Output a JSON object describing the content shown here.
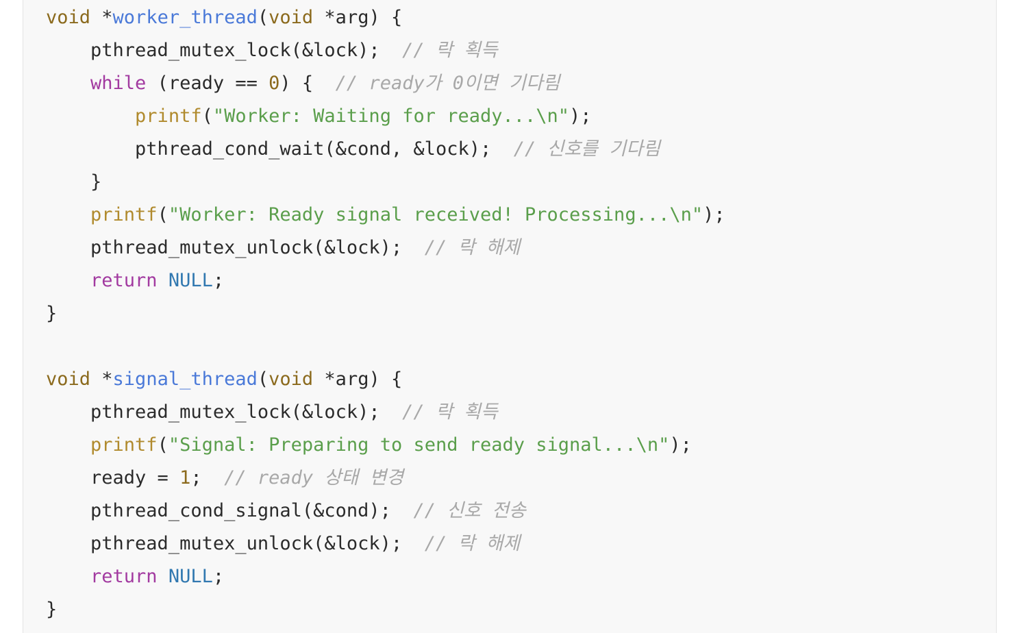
{
  "colors": {
    "background": "#f8f8f8",
    "page": "#ffffff",
    "border": "#e3e3e3",
    "plain": "#2b2b2b",
    "type": "#8b6a1d",
    "function_name": "#4a79d8",
    "keyword": "#a23aa0",
    "builtin": "#b08a2d",
    "string": "#5a9e4b",
    "number": "#8b6a1d",
    "constant": "#3178b0",
    "comment": "#a8a8a8"
  },
  "code": {
    "lines": [
      [
        {
          "t": "type",
          "v": "void"
        },
        {
          "t": "plain",
          "v": " *"
        },
        {
          "t": "func",
          "v": "worker_thread"
        },
        {
          "t": "plain",
          "v": "("
        },
        {
          "t": "type",
          "v": "void"
        },
        {
          "t": "plain",
          "v": " *arg) {"
        }
      ],
      [
        {
          "t": "plain",
          "v": "    pthread_mutex_lock(&lock);  "
        },
        {
          "t": "comment",
          "v": "// 락 획득"
        }
      ],
      [
        {
          "t": "plain",
          "v": "    "
        },
        {
          "t": "kw",
          "v": "while"
        },
        {
          "t": "plain",
          "v": " (ready == "
        },
        {
          "t": "num",
          "v": "0"
        },
        {
          "t": "plain",
          "v": ") {  "
        },
        {
          "t": "comment",
          "v": "// ready가 0이면 기다림"
        }
      ],
      [
        {
          "t": "plain",
          "v": "        "
        },
        {
          "t": "builtin",
          "v": "printf"
        },
        {
          "t": "plain",
          "v": "("
        },
        {
          "t": "string",
          "v": "\"Worker: Waiting for ready...\\n\""
        },
        {
          "t": "plain",
          "v": ");"
        }
      ],
      [
        {
          "t": "plain",
          "v": "        pthread_cond_wait(&cond, &lock);  "
        },
        {
          "t": "comment",
          "v": "// 신호를 기다림"
        }
      ],
      [
        {
          "t": "plain",
          "v": "    }"
        }
      ],
      [
        {
          "t": "plain",
          "v": "    "
        },
        {
          "t": "builtin",
          "v": "printf"
        },
        {
          "t": "plain",
          "v": "("
        },
        {
          "t": "string",
          "v": "\"Worker: Ready signal received! Processing...\\n\""
        },
        {
          "t": "plain",
          "v": ");"
        }
      ],
      [
        {
          "t": "plain",
          "v": "    pthread_mutex_unlock(&lock);  "
        },
        {
          "t": "comment",
          "v": "// 락 해제"
        }
      ],
      [
        {
          "t": "plain",
          "v": "    "
        },
        {
          "t": "kw",
          "v": "return"
        },
        {
          "t": "plain",
          "v": " "
        },
        {
          "t": "const",
          "v": "NULL"
        },
        {
          "t": "plain",
          "v": ";"
        }
      ],
      [
        {
          "t": "plain",
          "v": "}"
        }
      ],
      [],
      [
        {
          "t": "type",
          "v": "void"
        },
        {
          "t": "plain",
          "v": " *"
        },
        {
          "t": "func",
          "v": "signal_thread"
        },
        {
          "t": "plain",
          "v": "("
        },
        {
          "t": "type",
          "v": "void"
        },
        {
          "t": "plain",
          "v": " *arg) {"
        }
      ],
      [
        {
          "t": "plain",
          "v": "    pthread_mutex_lock(&lock);  "
        },
        {
          "t": "comment",
          "v": "// 락 획득"
        }
      ],
      [
        {
          "t": "plain",
          "v": "    "
        },
        {
          "t": "builtin",
          "v": "printf"
        },
        {
          "t": "plain",
          "v": "("
        },
        {
          "t": "string",
          "v": "\"Signal: Preparing to send ready signal...\\n\""
        },
        {
          "t": "plain",
          "v": ");"
        }
      ],
      [
        {
          "t": "plain",
          "v": "    ready = "
        },
        {
          "t": "num",
          "v": "1"
        },
        {
          "t": "plain",
          "v": ";  "
        },
        {
          "t": "comment",
          "v": "// ready 상태 변경"
        }
      ],
      [
        {
          "t": "plain",
          "v": "    pthread_cond_signal(&cond);  "
        },
        {
          "t": "comment",
          "v": "// 신호 전송"
        }
      ],
      [
        {
          "t": "plain",
          "v": "    pthread_mutex_unlock(&lock);  "
        },
        {
          "t": "comment",
          "v": "// 락 해제"
        }
      ],
      [
        {
          "t": "plain",
          "v": "    "
        },
        {
          "t": "kw",
          "v": "return"
        },
        {
          "t": "plain",
          "v": " "
        },
        {
          "t": "const",
          "v": "NULL"
        },
        {
          "t": "plain",
          "v": ";"
        }
      ],
      [
        {
          "t": "plain",
          "v": "}"
        }
      ]
    ]
  }
}
